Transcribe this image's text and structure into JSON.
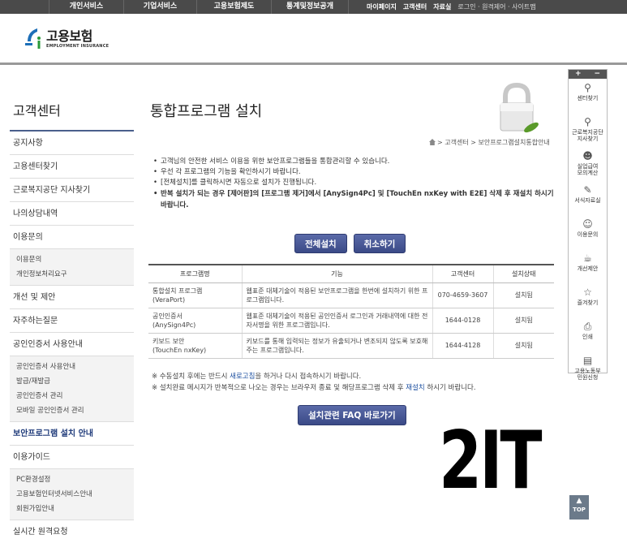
{
  "topnav": {
    "menu": [
      "개인서비스",
      "기업서비스",
      "고용보험제도",
      "통계및정보공개"
    ],
    "util": [
      "마이페이지",
      "고객센터",
      "자료실"
    ],
    "util_sub": "로그인 · 원격제어 · 사이트맵"
  },
  "logo": {
    "ko": "고용보험",
    "en": "EMPLOYMENT INSURANCE"
  },
  "sidebar": {
    "title": "고객센터",
    "items": [
      {
        "label": "공지사항"
      },
      {
        "label": "고용센터찾기"
      },
      {
        "label": "근로복지공단 지사찾기"
      },
      {
        "label": "나의상담내역"
      },
      {
        "label": "이용문의",
        "sub": [
          "이용문의",
          "개인정보처리요구"
        ]
      },
      {
        "label": "개선 및 제안"
      },
      {
        "label": "자주하는질문"
      },
      {
        "label": "공인인증서 사용안내",
        "sub": [
          "공인인증서 사용안내",
          "발급/재발급",
          "공인인증서 관리",
          "모바일 공인인증서 관리"
        ]
      },
      {
        "label": "보안프로그램 설치 안내",
        "active": true
      },
      {
        "label": "이용가이드",
        "sub": [
          "PC환경설정",
          "고용보험인터넷서비스안내",
          "회원가입안내"
        ]
      },
      {
        "label": "실시간 원격요청"
      }
    ]
  },
  "main": {
    "title": "통합프로그램 설치",
    "breadcrumb": "> 고객센터 > 보안프로그램설치통합안내",
    "notes": [
      "고객님의 안전한 서비스 이용을 위한 보안프로그램들을 통합관리할 수 있습니다.",
      "우선 각 프로그램의 기능을 확인하시기 바랍니다.",
      "[전체설치]를 클릭하시면 자동으로 설치가 진행됩니다."
    ],
    "warning": "반복 설치가 되는 경우 [제어판]의 [프로그램 제거]에서 [AnySign4Pc] 및 [TouchEn nxKey with E2E] 삭제 후 재설치 하시기 바랍니다.",
    "install_all": "전체설치",
    "cancel": "취소하기",
    "table": {
      "headers": [
        "프로그램명",
        "기능",
        "고객센터",
        "설치상태"
      ],
      "rows": [
        {
          "name": "통합설치 프로그램\n(VeraPort)",
          "func": "웹표준 대체기술이 적용된 보안프로그램을 한번에 설치하기 위한 프로그램입니다.",
          "phone": "070-4659-3607",
          "status": "설치됨"
        },
        {
          "name": "공인인증서\n(AnySign4Pc)",
          "func": "웹표준 대체기술이 적용된 공인인증서 로그인과 거래내역에 대한 전자서명을 위한 프로그램입니다.",
          "phone": "1644-0128",
          "status": "설치됨"
        },
        {
          "name": "키보드 보안\n(TouchEn nxKey)",
          "func": "키보드를 통해 입력되는 정보가 유출되거나 변조되지 않도록 보호해 주는 프로그램입니다.",
          "phone": "1644-4128",
          "status": "설치됨"
        }
      ]
    },
    "foot1_a": "※ 수동설치 후에는 반드시 ",
    "foot1_link": "새로고침",
    "foot1_b": "을 하거나 다시 접속하시기 바랍니다.",
    "foot2_a": "※ 설치완료 메시지가 반복적으로 나오는 경우는 브라우저 종료 및 해당프로그램 삭제 후 ",
    "foot2_link": "재설치",
    "foot2_b": " 하시기 바랍니다.",
    "faq": "설치관련 FAQ 바로가기"
  },
  "overlay_text": "2IT",
  "quick": {
    "head_plus": "+",
    "head_minus": "−",
    "items": [
      {
        "icon": "location-pin-icon",
        "label": "센터찾기"
      },
      {
        "icon": "location-pin-icon",
        "label": "근로복지공단\n지사찾기"
      },
      {
        "icon": "person-icon",
        "label": "실업급여\n모의계산"
      },
      {
        "icon": "pencil-icon",
        "label": "서식자료실"
      },
      {
        "icon": "chat-icon",
        "label": "이용문의"
      },
      {
        "icon": "cup-icon",
        "label": "개선제안"
      },
      {
        "icon": "star-icon",
        "label": "즐겨찾기"
      },
      {
        "icon": "printer-icon",
        "label": "인쇄"
      },
      {
        "icon": "document-icon",
        "label": "고용노동부\n민원신청"
      }
    ],
    "top": "TOP"
  }
}
